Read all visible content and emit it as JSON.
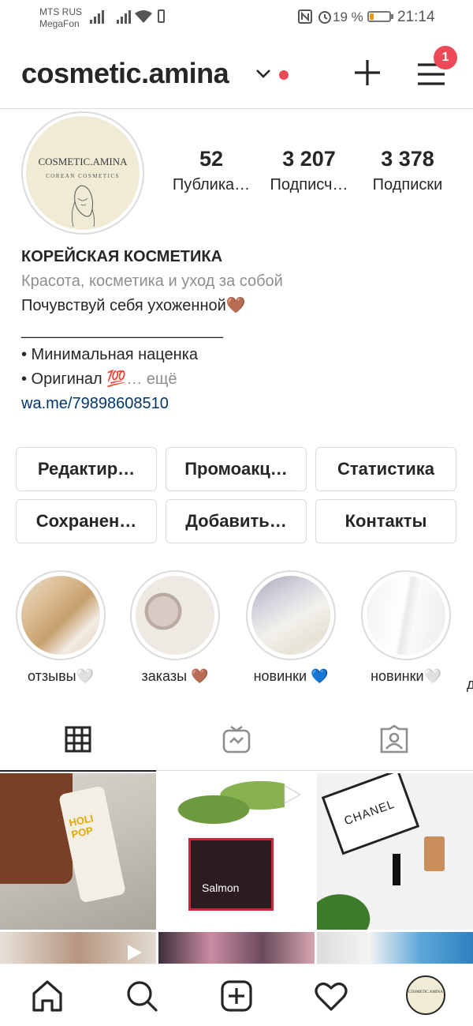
{
  "status_bar": {
    "carrier1": "MTS RUS",
    "carrier2": "MegaFon",
    "battery_pct": "19 %",
    "battery_level": 0.19,
    "time": "21:14"
  },
  "header": {
    "username": "cosmetic.amina",
    "notifications": "1"
  },
  "profile": {
    "avatar_title": "COSMETIC.AMINA",
    "avatar_subtitle": "COREAN COSMETICS",
    "nav_avatar_text": "COSMETIC.AMINA",
    "stats": [
      {
        "value": "52",
        "label": "Публика…"
      },
      {
        "value": "3 207",
        "label": "Подписч…"
      },
      {
        "value": "3 378",
        "label": "Подписки"
      }
    ],
    "bio": {
      "name": "КОРЕЙСКАЯ КОСМЕТИКА",
      "category": "Красота, косметика и уход за собой",
      "line1": "Почувствуй себя ухоженной🤎",
      "line2": "_______________________",
      "line3": "• Минимальная наценка",
      "line4": "• Оригинал 💯",
      "more": "… ещё",
      "link": "wa.me/79898608510"
    }
  },
  "buttons": {
    "edit": "Редактир…",
    "promo": "Промоакц…",
    "stats": "Статистика",
    "saved": "Сохранен…",
    "add": "Добавить…",
    "contacts": "Контакты"
  },
  "highlights": [
    {
      "label": "отзывы🤍"
    },
    {
      "label": "заказы 🤎"
    },
    {
      "label": "новинки 💙"
    },
    {
      "label": "новинки🤍"
    },
    {
      "label": "д"
    }
  ],
  "grid": {
    "post_brand": "CHANEL",
    "post_product1": "HOLI POP",
    "post_product2": "Salmon"
  },
  "colors": {
    "accent_red": "#ed4956",
    "link": "#00376b",
    "secondary_text": "#8e8e8e",
    "border": "#dbdbdb",
    "avatar_bg": "#efebd4"
  }
}
